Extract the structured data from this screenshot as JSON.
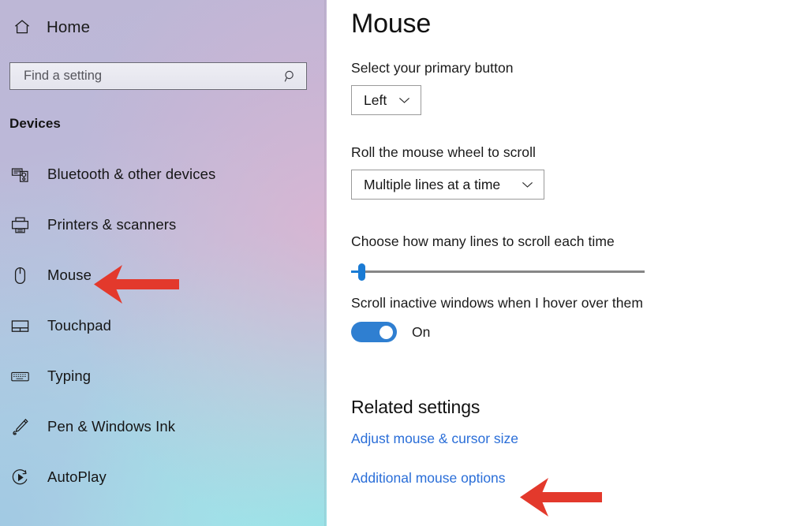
{
  "sidebar": {
    "home": {
      "label": "Home",
      "icon": "home-icon"
    },
    "search": {
      "value": "",
      "placeholder": "Find a setting",
      "icon": "search-icon"
    },
    "section_title": "Devices",
    "items": [
      {
        "label": "Bluetooth & other devices",
        "icon": "bluetooth-devices-icon"
      },
      {
        "label": "Printers & scanners",
        "icon": "printer-icon"
      },
      {
        "label": "Mouse",
        "icon": "mouse-icon"
      },
      {
        "label": "Touchpad",
        "icon": "touchpad-icon"
      },
      {
        "label": "Typing",
        "icon": "keyboard-icon"
      },
      {
        "label": "Pen & Windows Ink",
        "icon": "pen-icon"
      },
      {
        "label": "AutoPlay",
        "icon": "autoplay-icon"
      }
    ]
  },
  "main": {
    "title": "Mouse",
    "primary_button": {
      "label": "Select your primary button",
      "value": "Left",
      "chevron": "chevron-down-icon"
    },
    "wheel_scroll": {
      "label": "Roll the mouse wheel to scroll",
      "value": "Multiple lines at a time",
      "chevron": "chevron-down-icon"
    },
    "lines_slider": {
      "label": "Choose how many lines to scroll each time",
      "value": 1,
      "min": 1,
      "max": 100
    },
    "inactive_scroll": {
      "label": "Scroll inactive windows when I hover over them",
      "state": "On",
      "checked": true
    },
    "related": {
      "title": "Related settings",
      "links": [
        "Adjust mouse & cursor size",
        "Additional mouse options"
      ]
    }
  },
  "annotations": {
    "arrow_color": "#e3392c",
    "arrows": [
      {
        "name": "arrow-pointing-to-mouse",
        "target": "Mouse"
      },
      {
        "name": "arrow-pointing-to-additional-mouse-options",
        "target": "Additional mouse options"
      }
    ]
  },
  "colors": {
    "accent_blue": "#2f7fd1",
    "link_blue": "#2a6ed8",
    "slider_blue": "#1a7bd4",
    "arrow_red": "#e3392c",
    "content_bg": "#ffffff"
  }
}
